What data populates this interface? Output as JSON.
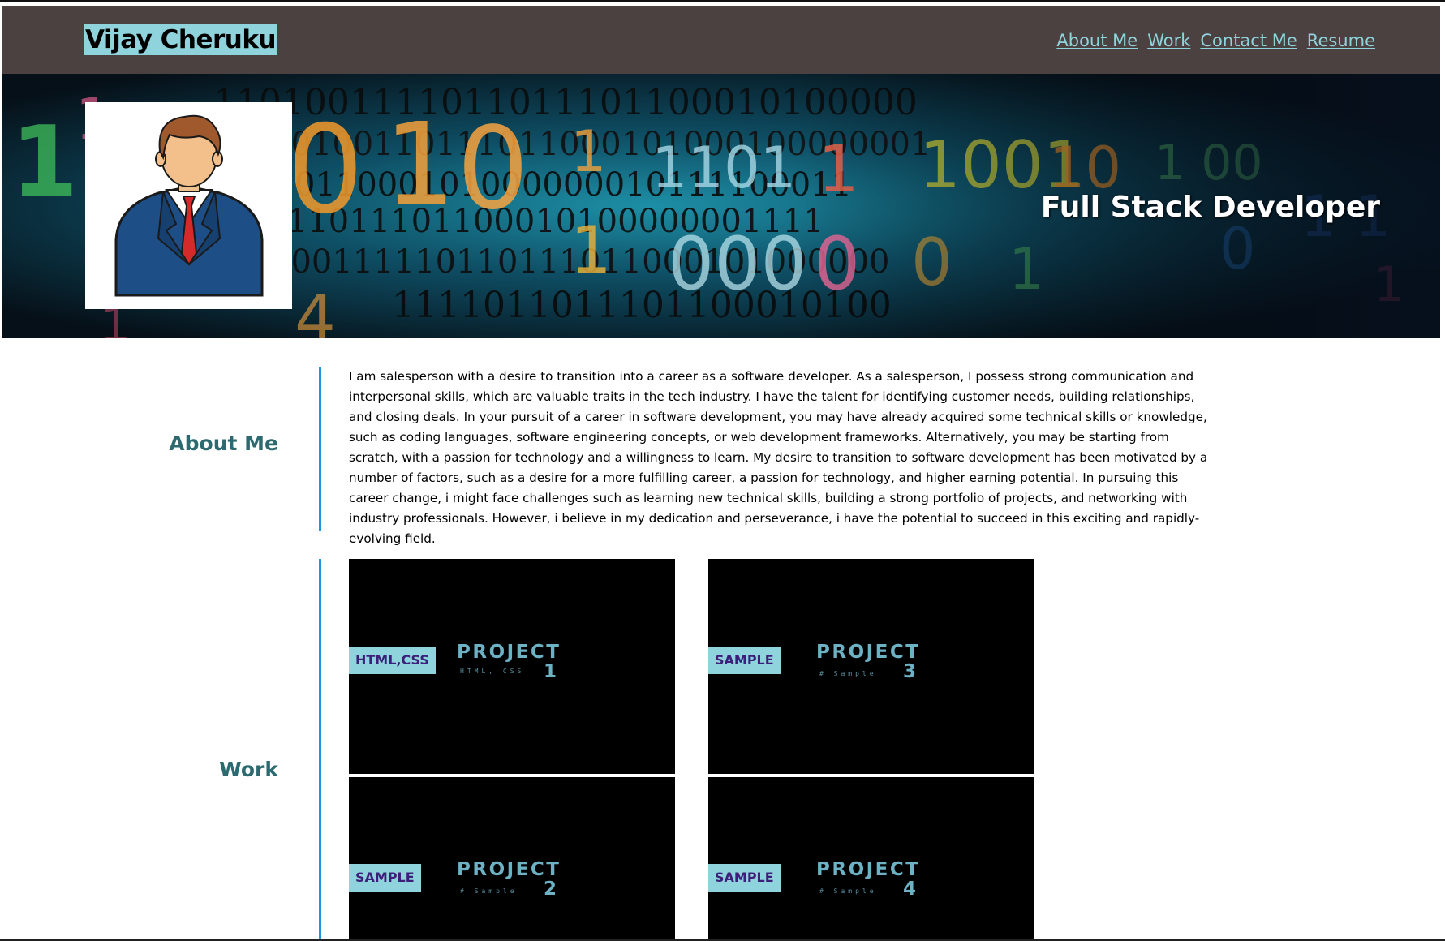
{
  "header": {
    "site_title": "Vijay Cheruku",
    "nav": [
      {
        "label": "About Me"
      },
      {
        "label": "Work"
      },
      {
        "label": "Contact Me"
      },
      {
        "label": "Resume"
      }
    ]
  },
  "hero": {
    "title": "Full Stack Developer",
    "background": "binary-code-image",
    "avatar": "businessman-avatar-icon"
  },
  "about": {
    "heading": "About Me",
    "text": "I am salesperson with a desire to transition into a career as a software developer. As a salesperson, I possess strong communication and interpersonal skills, which are valuable traits in the tech industry. I have the talent for identifying customer needs, building relationships, and closing deals. In your pursuit of a career in software development, you may have already acquired some technical skills or knowledge, such as coding languages, software engineering concepts, or web development frameworks. Alternatively, you may be starting from scratch, with a passion for technology and a willingness to learn. My desire to transition to software development has been motivated by a number of factors, such as a desire for a more fulfilling career, a passion for technology, and higher earning potential. In pursuing this career change, i might face challenges such as learning new technical skills, building a strong portfolio of projects, and networking with industry professionals. However, i believe in my dedication and perseverance, i have the potential to succeed in this exciting and rapidly-evolving field."
  },
  "work": {
    "heading": "Work",
    "projects": [
      {
        "tag": "HTML,CSS",
        "word": "PROJECT",
        "sub": "HTML, CSS",
        "num": "1"
      },
      {
        "tag": "SAMPLE",
        "word": "PROJECT",
        "sub": "# Sample",
        "num": "3"
      },
      {
        "tag": "SAMPLE",
        "word": "PROJECT",
        "sub": "# Sample",
        "num": "2"
      },
      {
        "tag": "SAMPLE",
        "word": "PROJECT",
        "sub": "# Sample",
        "num": "4"
      }
    ]
  },
  "colors": {
    "header_bg": "#4a4140",
    "accent": "#8fd3dc",
    "heading": "#2d6a70",
    "divider": "#2196e0",
    "tag_text": "#3c1f7a"
  }
}
